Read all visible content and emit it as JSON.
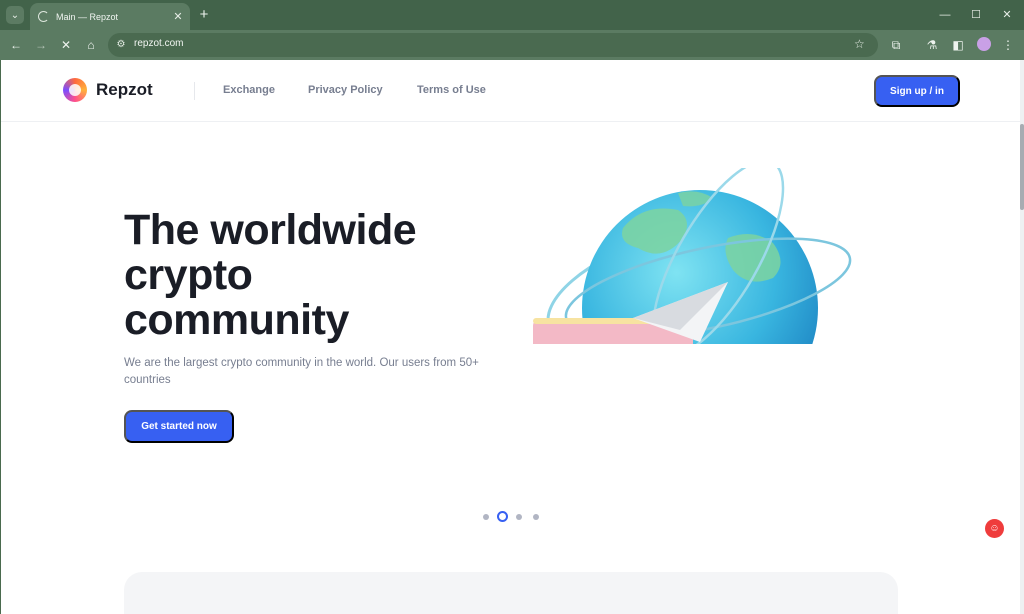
{
  "browser": {
    "tab_title": "Main — Repzot",
    "url": "repzot.com",
    "icons": {
      "tab_search": "chevron-down-icon",
      "tab_spinner": "loading-spinner-icon",
      "tab_close": "close-icon",
      "new_tab": "plus-icon",
      "minimize": "minimize-icon",
      "maximize": "maximize-icon",
      "window_close": "close-icon",
      "back": "arrow-left-icon",
      "forward": "arrow-right-icon",
      "stop": "stop-loading-icon",
      "home": "home-icon",
      "site_info": "site-settings-icon",
      "bookmark": "star-icon",
      "extensions": "puzzle-icon",
      "labs": "flask-icon",
      "side_panel": "side-panel-icon",
      "profile": "avatar",
      "menu": "kebab-menu-icon"
    },
    "glyphs": {
      "tab_search": "⌄",
      "tab_close": "✕",
      "new_tab": "+",
      "minimize": "—",
      "maximize": "☐",
      "window_close": "✕",
      "back": "←",
      "forward": "→",
      "stop": "✕",
      "home": "⌂",
      "site_info": "⚙",
      "bookmark": "☆",
      "extensions": "⧉",
      "labs": "⚗",
      "side_panel": "◧",
      "menu": "⋮"
    }
  },
  "site": {
    "brand": "Repzot",
    "nav": {
      "exchange": "Exchange",
      "privacy": "Privacy Policy",
      "terms": "Terms of Use"
    },
    "signup_label": "Sign up / in",
    "hero": {
      "title_line1": "The worldwide",
      "title_line2": "crypto",
      "title_line3": "community",
      "subtitle": "We are the largest crypto community in the world. Our users from 50+ countries",
      "cta_label": "Get started now"
    },
    "carousel": {
      "slide_count": 4,
      "active_index": 1
    },
    "help_glyph": "☺",
    "colors": {
      "accent": "#3760f2",
      "heading": "#1a1d26",
      "muted": "#777e90",
      "chrome": "#5b7b62",
      "help": "#ef3c3c"
    }
  }
}
